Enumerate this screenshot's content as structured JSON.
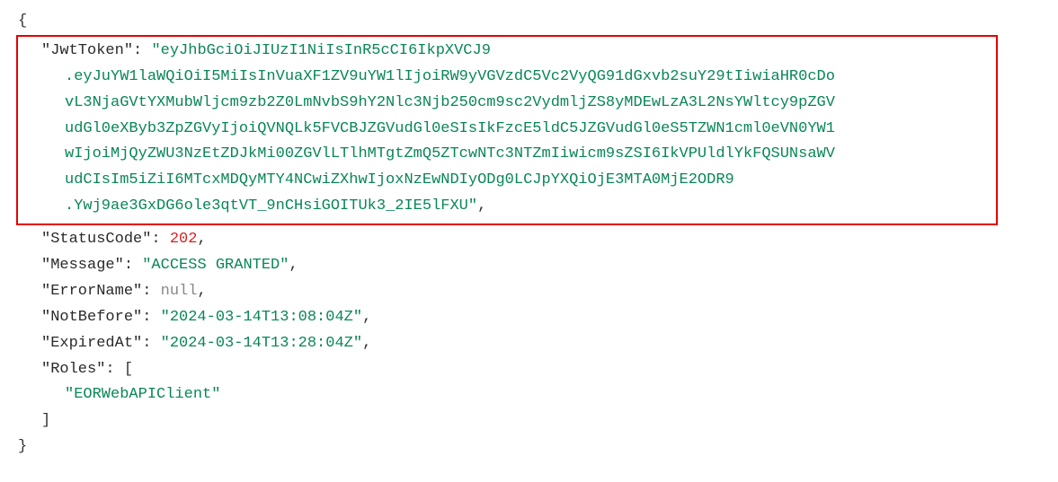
{
  "json": {
    "keys": {
      "JwtToken": "\"JwtToken\"",
      "StatusCode": "\"StatusCode\"",
      "Message": "\"Message\"",
      "ErrorName": "\"ErrorName\"",
      "NotBefore": "\"NotBefore\"",
      "ExpiredAt": "\"ExpiredAt\"",
      "Roles": "\"Roles\""
    },
    "values": {
      "StatusCode": "202",
      "Message": "\"ACCESS GRANTED\"",
      "ErrorName": "null",
      "NotBefore": "\"2024-03-14T13:08:04Z\"",
      "ExpiredAt": "\"2024-03-14T13:28:04Z\"",
      "RolesItem0": "\"EORWebAPIClient\""
    },
    "token": {
      "line1": "\"eyJhbGciOiJIUzI1NiIsInR5cCI6IkpXVCJ9",
      "line2": ".eyJuYW1laWQiOiI5MiIsInVuaXF1ZV9uYW1lIjoiRW9yVGVzdC5Vc2VyQG91dGxvb2suY29tIiwiaHR0cDo",
      "line3": "vL3NjaGVtYXMubWljcm9zb2Z0LmNvbS9hY2Nlc3Njb250cm9sc2VydmljZS8yMDEwLzA3L2NsYWltcy9pZGV",
      "line4": "udGl0eXByb3ZpZGVyIjoiQVNQLk5FVCBJZGVudGl0eSIsIkFzcE5ldC5JZGVudGl0eS5TZWN1cml0eVN0YW1",
      "line5": "wIjoiMjQyZWU3NzEtZDJkMi00ZGVlLTlhMTgtZmQ5ZTcwNTc3NTZmIiwicm9sZSI6IkVPUldlYkFQSUNsaWV",
      "line6": "udCIsIm5iZiI6MTcxMDQyMTY4NCwiZXhwIjoxNzEwNDIyODg0LCJpYXQiOjE3MTA0MjE2ODR9",
      "line7": ".Ywj9ae3GxDG6ole3qtVT_9nCHsiGOITUk3_2IE5lFXU\""
    },
    "punct": {
      "openBrace": "{",
      "closeBrace": "}",
      "openBracket": "[",
      "closeBracket": "]",
      "colon": ":",
      "comma": ","
    }
  }
}
